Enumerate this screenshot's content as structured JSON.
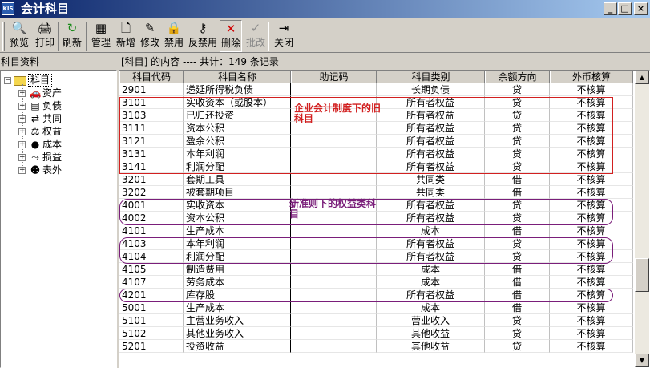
{
  "window": {
    "title": "会计科目",
    "icon_text": "KIS",
    "min_label": "_",
    "max_label": "□",
    "close_label": "×"
  },
  "toolbar": [
    {
      "name": "preview",
      "label": "预览",
      "icon": "preview-icon",
      "glyph": "🔍"
    },
    {
      "name": "print",
      "label": "打印",
      "icon": "printer-icon",
      "glyph": "🖨"
    },
    {
      "name": "refresh",
      "label": "刷新",
      "icon": "refresh-icon",
      "glyph": "↻"
    },
    {
      "name": "manage",
      "label": "管理",
      "icon": "manage-icon",
      "glyph": "▦"
    },
    {
      "name": "new",
      "label": "新增",
      "icon": "new-doc-icon",
      "glyph": "🗋"
    },
    {
      "name": "edit",
      "label": "修改",
      "icon": "edit-icon",
      "glyph": "✎"
    },
    {
      "name": "disable",
      "label": "禁用",
      "icon": "lock-icon",
      "glyph": "🔒"
    },
    {
      "name": "undisable",
      "label": "反禁用",
      "icon": "key-icon",
      "glyph": "⚷"
    },
    {
      "name": "delete",
      "label": "删除",
      "icon": "delete-icon",
      "glyph": "✕"
    },
    {
      "name": "approve",
      "label": "批改",
      "icon": "approve-icon",
      "glyph": "✓"
    },
    {
      "name": "close",
      "label": "关闭",
      "icon": "exit-icon",
      "glyph": "⇥"
    }
  ],
  "left_panel": {
    "title": "科目资料",
    "root": {
      "label": "科目",
      "expander": "−"
    },
    "items": [
      {
        "label": "资产",
        "icon": "assets-icon",
        "glyph": "🚗"
      },
      {
        "label": "负债",
        "icon": "liabilities-icon",
        "glyph": "▤"
      },
      {
        "label": "共同",
        "icon": "common-icon",
        "glyph": "⇄"
      },
      {
        "label": "权益",
        "icon": "equity-icon",
        "glyph": "⚖"
      },
      {
        "label": "成本",
        "icon": "cost-icon",
        "glyph": "●"
      },
      {
        "label": "损益",
        "icon": "profit-loss-icon",
        "glyph": "⤳"
      },
      {
        "label": "表外",
        "icon": "off-balance-icon",
        "glyph": "☻"
      }
    ],
    "expander_plus": "+"
  },
  "info_bar": "[科目] 的内容  ---- 共计：149 条记录",
  "table": {
    "columns": [
      "科目代码",
      "科目名称",
      "助记码",
      "科目类别",
      "余额方向",
      "外币核算"
    ],
    "rows": [
      [
        "2901",
        "递延所得税负债",
        "",
        "长期负债",
        "贷",
        "不核算"
      ],
      [
        "3101",
        "实收资本（或股本）",
        "",
        "所有者权益",
        "贷",
        "不核算"
      ],
      [
        "3103",
        "已归还投资",
        "",
        "所有者权益",
        "贷",
        "不核算"
      ],
      [
        "3111",
        "资本公积",
        "",
        "所有者权益",
        "贷",
        "不核算"
      ],
      [
        "3121",
        "盈余公积",
        "",
        "所有者权益",
        "贷",
        "不核算"
      ],
      [
        "3131",
        "本年利润",
        "",
        "所有者权益",
        "贷",
        "不核算"
      ],
      [
        "3141",
        "利润分配",
        "",
        "所有者权益",
        "贷",
        "不核算"
      ],
      [
        "3201",
        "套期工具",
        "",
        "共同类",
        "借",
        "不核算"
      ],
      [
        "3202",
        "被套期项目",
        "",
        "共同类",
        "借",
        "不核算"
      ],
      [
        "4001",
        "实收资本",
        "",
        "所有者权益",
        "贷",
        "不核算"
      ],
      [
        "4002",
        "资本公积",
        "",
        "所有者权益",
        "贷",
        "不核算"
      ],
      [
        "4101",
        "生产成本",
        "",
        "成本",
        "借",
        "不核算"
      ],
      [
        "4103",
        "本年利润",
        "",
        "所有者权益",
        "贷",
        "不核算"
      ],
      [
        "4104",
        "利润分配",
        "",
        "所有者权益",
        "贷",
        "不核算"
      ],
      [
        "4105",
        "制造费用",
        "",
        "成本",
        "借",
        "不核算"
      ],
      [
        "4107",
        "劳务成本",
        "",
        "成本",
        "借",
        "不核算"
      ],
      [
        "4201",
        "库存股",
        "",
        "所有者权益",
        "借",
        "不核算"
      ],
      [
        "5001",
        "生产成本",
        "",
        "成本",
        "借",
        "不核算"
      ],
      [
        "5101",
        "主营业务收入",
        "",
        "营业收入",
        "贷",
        "不核算"
      ],
      [
        "5102",
        "其他业务收入",
        "",
        "其他收益",
        "贷",
        "不核算"
      ],
      [
        "5201",
        "投资收益",
        "",
        "其他收益",
        "贷",
        "不核算"
      ]
    ]
  },
  "annotations": {
    "old_label": "企业会计制度下的旧科目",
    "new_label": "新准则下的权益类科目",
    "old_color": "#d22020",
    "new_color": "#7a1e7a"
  },
  "scrollbar": {
    "up": "▲",
    "down": "▼"
  }
}
